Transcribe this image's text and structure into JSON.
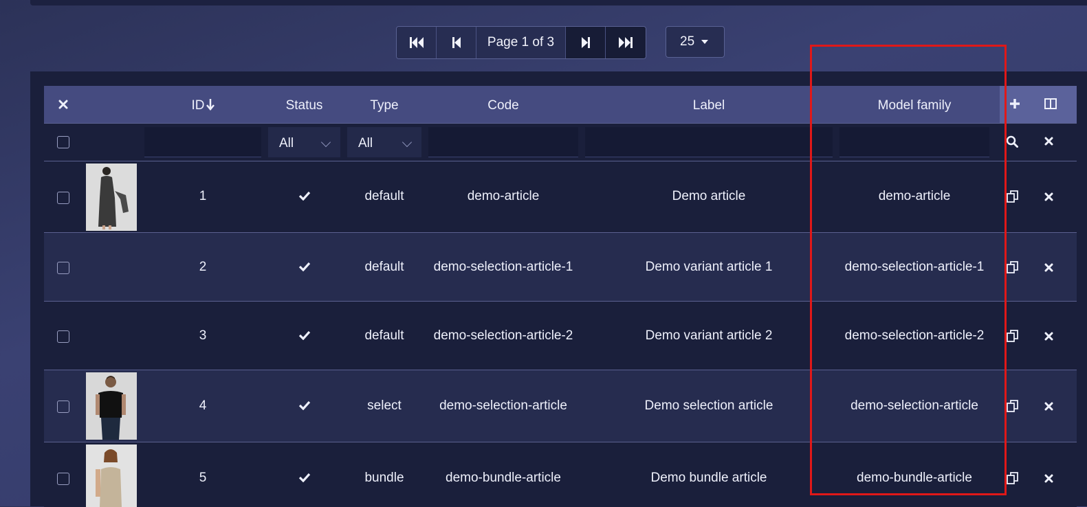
{
  "pagination": {
    "first_label": "first-page",
    "prev_label": "previous-page",
    "info": "Page 1 of 3",
    "next_label": "next-page",
    "last_label": "last-page",
    "per_page": "25"
  },
  "table": {
    "columns": [
      "ID",
      "Status",
      "Type",
      "Code",
      "Label",
      "Model family"
    ],
    "filters": {
      "status": "All",
      "type": "All"
    },
    "rows": [
      {
        "id": "1",
        "type": "default",
        "code": "demo-article",
        "label": "Demo article",
        "model_family": "demo-article",
        "has_image": true
      },
      {
        "id": "2",
        "type": "default",
        "code": "demo-selection-article-1",
        "label": "Demo variant article 1",
        "model_family": "demo-selection-article-1",
        "has_image": false
      },
      {
        "id": "3",
        "type": "default",
        "code": "demo-selection-article-2",
        "label": "Demo variant article 2",
        "model_family": "demo-selection-article-2",
        "has_image": false
      },
      {
        "id": "4",
        "type": "select",
        "code": "demo-selection-article",
        "label": "Demo selection article",
        "model_family": "demo-selection-article",
        "has_image": true
      },
      {
        "id": "5",
        "type": "bundle",
        "code": "demo-bundle-article",
        "label": "Demo bundle article",
        "model_family": "demo-bundle-article",
        "has_image": true
      }
    ]
  },
  "colors": {
    "header_bg": "#454b80",
    "row_odd": "#1a1f3b",
    "row_even": "#262c4f",
    "highlight": "#e01818"
  }
}
